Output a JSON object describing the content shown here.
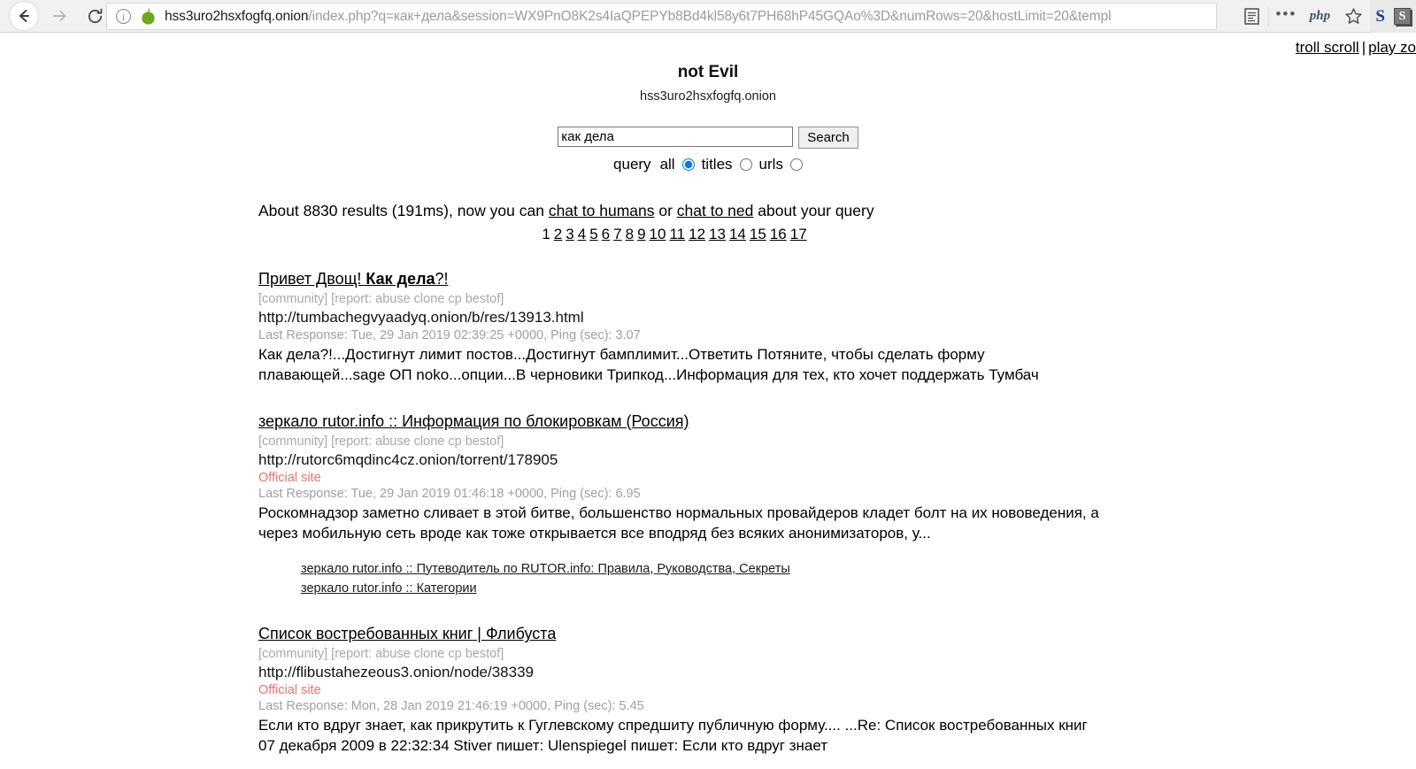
{
  "browser": {
    "back_label": "back-arrow",
    "forward_label": "forward-arrow",
    "reload_label": "reload",
    "url_host": "hss3uro2hsxfogfq.onion",
    "url_path": "/index.php?q=как+дела&session=WX9PnO8K2s4IaQPEPYb8Bd4kl58y6t7PH68hP45GQAo%3D&numRows=20&hostLimit=20&templ",
    "reader_icon": "reader-mode-icon",
    "menu_dots": "•••",
    "php_label": "php",
    "star_icon": "bookmark-star-icon",
    "ext_s_blue": "S",
    "ext_s_grey": "S"
  },
  "top_links": {
    "troll_scroll": "troll scroll",
    "separator": "|",
    "play_zo": "play zo"
  },
  "header": {
    "title": "not Evil",
    "domain": "hss3uro2hsxfogfq.onion"
  },
  "search": {
    "value": "как дела",
    "placeholder": "",
    "button_label": "Search",
    "query_label": "query",
    "options": [
      {
        "label": "all",
        "selected": true
      },
      {
        "label": "titles",
        "selected": false
      },
      {
        "label": "urls",
        "selected": false
      }
    ]
  },
  "results_info": {
    "prefix": "About 8830 results (191ms), now you can ",
    "link_humans": "chat to humans",
    "middle": " or ",
    "link_ned": "chat to ned",
    "suffix": " about your query",
    "count": "8830",
    "time_ms": "191ms"
  },
  "pagination": {
    "current": "1",
    "pages": [
      "2",
      "3",
      "4",
      "5",
      "6",
      "7",
      "8",
      "9",
      "10",
      "11",
      "12",
      "13",
      "14",
      "15",
      "16",
      "17"
    ]
  },
  "results": [
    {
      "title_plain_before": "Привет Двощ! ",
      "title_bold": "Как дела",
      "title_plain_after": "?!",
      "tags": "[community] [report: abuse clone cp bestof]",
      "url": "http://tumbachegvyaadyq.onion/b/res/13913.html",
      "official": "",
      "meta": "Last Response: Tue, 29 Jan 2019 02:39:25 +0000, Ping (sec): 3.07",
      "snippet": "Как дела?!...Достигнут лимит постов...Достигнут бамплимит...Ответить Потяните, чтобы сделать форму плавающей...sage ОП noko...опции...В черновики Трипкод...Информация для тех, кто хочет поддержать Тумбач",
      "sublinks": []
    },
    {
      "title_plain_before": "зеркало rutor.info :: Информация по блокировкам (Россия)",
      "title_bold": "",
      "title_plain_after": "",
      "tags": "[community] [report: abuse clone cp bestof]",
      "url": "http://rutorc6mqdinc4cz.onion/torrent/178905",
      "official": "Official site",
      "meta": "Last Response: Tue, 29 Jan 2019 01:46:18 +0000, Ping (sec): 6.95",
      "snippet": "Роскомнадзор заметно сливает в этой битве, большенство нормальных провайдеров кладет болт на их нововедения, а через мобильную сеть вроде как тоже открывается все вподряд без всяких анонимизаторов, у...",
      "sublinks": [
        "зеркало rutor.info :: Путеводитель по RUTOR.info: Правила, Руководства, Секреты",
        "зеркало rutor.info :: Категории"
      ]
    },
    {
      "title_plain_before": "Список востребованных книг | Флибуста",
      "title_bold": "",
      "title_plain_after": "",
      "tags": "[community] [report: abuse clone cp bestof]",
      "url": "http://flibustahezeous3.onion/node/38339",
      "official": "Official site",
      "meta": "Last Response: Mon, 28 Jan 2019 21:46:19 +0000, Ping (sec): 5.45",
      "snippet": "Если кто вдруг знает, как прикрутить к Гуглевскому спредшиту публичную форму.... ...Re: Список востребованных книг  07 декабря 2009  в 22:32:34 Stiver пишет:   Ulenspiegel пишет:   Если кто вдруг знает",
      "sublinks": []
    }
  ],
  "colors": {
    "official_site": "#f0706b",
    "meta_grey": "#a0a0a0",
    "tag_grey": "#a8a8a8",
    "onion_green": "#6aa81e"
  }
}
